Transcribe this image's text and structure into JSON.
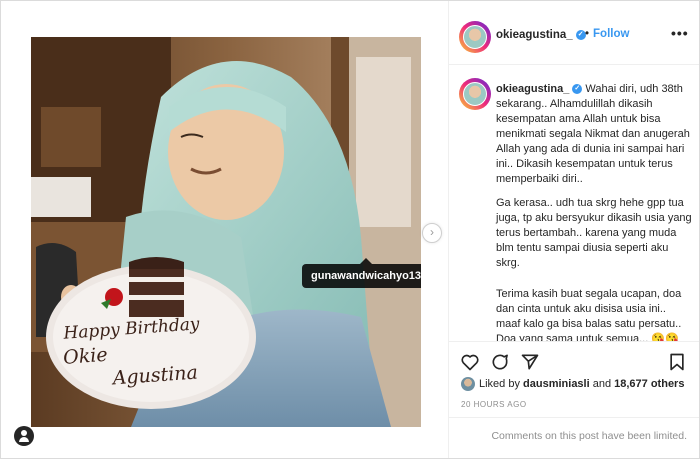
{
  "post": {
    "photo": {
      "description_icon": "photo",
      "cake_plate_line1": "Happy Birthday",
      "cake_plate_line2": "Okie",
      "cake_plate_line3": "Agustina",
      "tag_label": "gunawandwicahyo13"
    },
    "carousel_next_icon": "chevron-right-icon",
    "tagged_user_icon": "person-icon"
  },
  "header": {
    "username": "okieagustina_",
    "verified_icon": "verified-badge-icon",
    "separator": "•",
    "follow_label": "Follow",
    "more_icon": "more-options-icon",
    "more_label": "•••"
  },
  "caption": {
    "username": "okieagustina_",
    "paragraphs": [
      "Wahai diri, udh 38th sekarang.. Alhamdulillah dikasih kesempatan ama Allah untuk bisa menikmati segala Nikmat dan anugerah Allah yang ada di dunia ini sampai hari ini.. Dikasih kesempatan untuk terus memperbaiki diri..",
      "Ga kerasa.. udh tua skrg hehe gpp tua juga, tp aku bersyukur dikasih usia yang terus bertambah.. karena yang muda blm tentu sampai diusia seperti aku skrg.",
      "Terima kasih buat segala ucapan, doa dan cinta untuk aku disisa usia ini.. maaf kalo ga bisa balas satu persatu.. Doa yang sama untuk semua... 😘😘"
    ]
  },
  "actions": {
    "like_icon": "heart-icon",
    "comment_icon": "comment-icon",
    "share_icon": "share-icon",
    "save_icon": "bookmark-icon"
  },
  "likes": {
    "prefix": "Liked by ",
    "user": "dausminiasli",
    "middle": " and ",
    "others": "18,677 others"
  },
  "timestamp": "20 HOURS AGO",
  "comments_notice": "Comments on this post have been limited."
}
